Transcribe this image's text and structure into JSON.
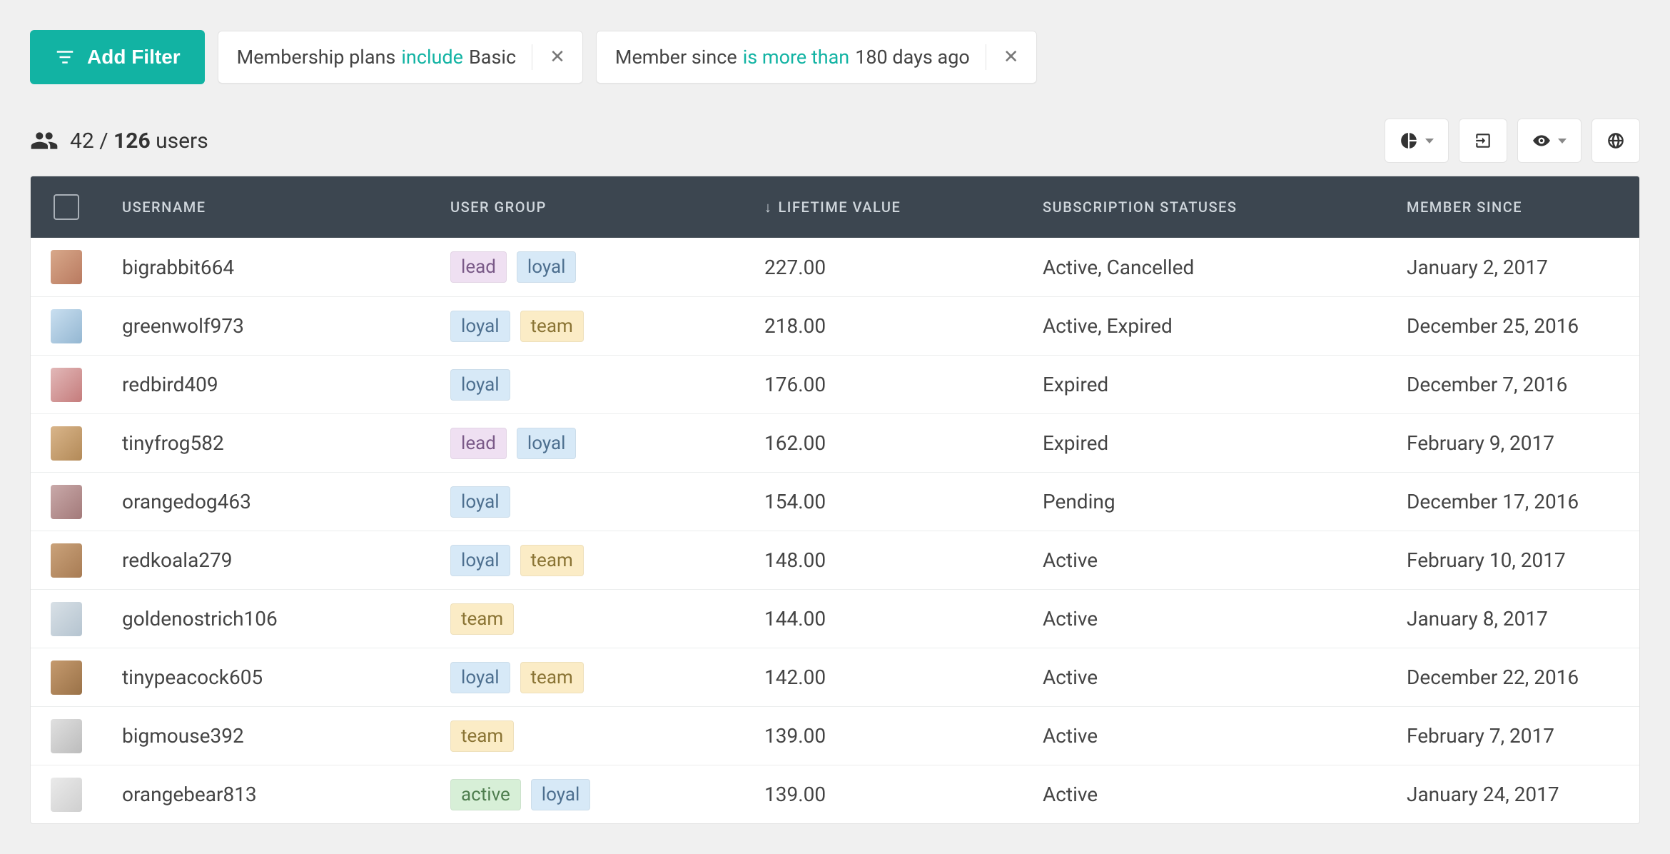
{
  "toolbar": {
    "add_filter_label": "Add Filter",
    "filters": [
      {
        "field": "Membership plans",
        "operator": "include",
        "value": "Basic"
      },
      {
        "field": "Member since",
        "operator": "is more than",
        "value": "180 days ago"
      }
    ]
  },
  "summary": {
    "filtered_count": "42",
    "separator": "/",
    "total_count": "126",
    "unit_label": "users"
  },
  "columns": {
    "username": "USERNAME",
    "user_group": "USER GROUP",
    "lifetime_value_prefix": "↓",
    "lifetime_value": "LIFETIME VALUE",
    "subscription_statuses": "SUBSCRIPTION STATUSES",
    "member_since": "MEMBER SINCE"
  },
  "tag_colors": {
    "lead": "#efe0f2",
    "loyal": "#d7e9f7",
    "team": "#fbecc6",
    "active": "#d7efd7"
  },
  "rows": [
    {
      "username": "bigrabbit664",
      "groups": [
        "lead",
        "loyal"
      ],
      "lifetime_value": "227.00",
      "statuses": "Active, Cancelled",
      "member_since": "January 2, 2017"
    },
    {
      "username": "greenwolf973",
      "groups": [
        "loyal",
        "team"
      ],
      "lifetime_value": "218.00",
      "statuses": "Active, Expired",
      "member_since": "December 25, 2016"
    },
    {
      "username": "redbird409",
      "groups": [
        "loyal"
      ],
      "lifetime_value": "176.00",
      "statuses": "Expired",
      "member_since": "December 7, 2016"
    },
    {
      "username": "tinyfrog582",
      "groups": [
        "lead",
        "loyal"
      ],
      "lifetime_value": "162.00",
      "statuses": "Expired",
      "member_since": "February 9, 2017"
    },
    {
      "username": "orangedog463",
      "groups": [
        "loyal"
      ],
      "lifetime_value": "154.00",
      "statuses": "Pending",
      "member_since": "December 17, 2016"
    },
    {
      "username": "redkoala279",
      "groups": [
        "loyal",
        "team"
      ],
      "lifetime_value": "148.00",
      "statuses": "Active",
      "member_since": "February 10, 2017"
    },
    {
      "username": "goldenostrich106",
      "groups": [
        "team"
      ],
      "lifetime_value": "144.00",
      "statuses": "Active",
      "member_since": "January 8, 2017"
    },
    {
      "username": "tinypeacock605",
      "groups": [
        "loyal",
        "team"
      ],
      "lifetime_value": "142.00",
      "statuses": "Active",
      "member_since": "December 22, 2016"
    },
    {
      "username": "bigmouse392",
      "groups": [
        "team"
      ],
      "lifetime_value": "139.00",
      "statuses": "Active",
      "member_since": "February 7, 2017"
    },
    {
      "username": "orangebear813",
      "groups": [
        "active",
        "loyal"
      ],
      "lifetime_value": "139.00",
      "statuses": "Active",
      "member_since": "January 24, 2017"
    }
  ]
}
